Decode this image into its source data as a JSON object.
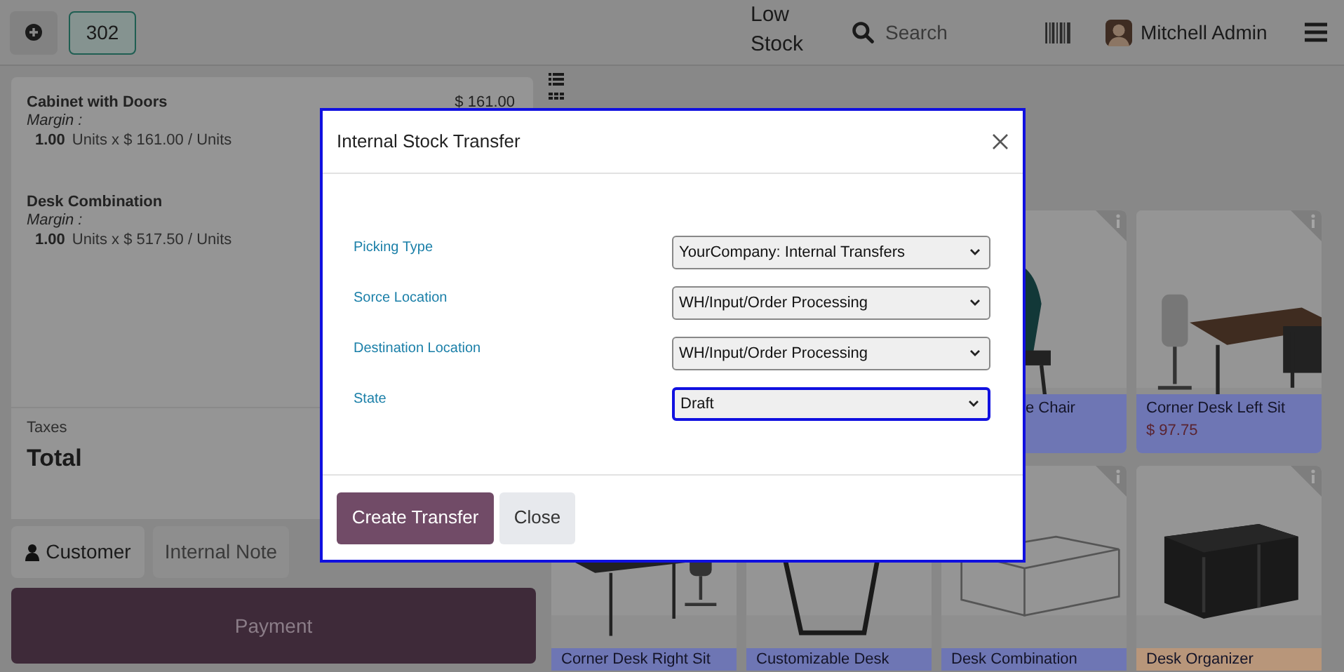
{
  "topbar": {
    "order_number": "302",
    "low_stock": "Low Stock",
    "search": {
      "placeholder": "Search"
    },
    "user": "Mitchell Admin"
  },
  "order_lines": [
    {
      "name": "Cabinet with Doors",
      "margin": "Margin :",
      "quantity": "1.00",
      "unit_price": "Units x $ 161.00 / Units",
      "price": "$ 161.00"
    },
    {
      "name": "Desk Combination",
      "margin": "Margin :",
      "quantity": "1.00",
      "unit_price": "Units x $ 517.50 / Units"
    }
  ],
  "totals": {
    "taxes": "Taxes",
    "total": "Total"
  },
  "actions": {
    "customer": "Customer",
    "internal_note": "Internal Note",
    "payment": "Payment"
  },
  "top_row": [
    {
      "name": "e Chair",
      "kind": "partial",
      "color": "#6e76b4"
    },
    {
      "name": "Corner Desk Left Sit",
      "price": "$ 97.75",
      "kind": "full",
      "color": "#6e76b4"
    }
  ],
  "bottom_row": [
    {
      "name": "Corner Desk Right Sit",
      "color": "#6e76b4"
    },
    {
      "name": "Customizable Desk",
      "color": "#6e76b4"
    },
    {
      "name": "Desk Combination",
      "color": "#6e76b4"
    },
    {
      "name": "Desk Organizer",
      "color": "#b8967a"
    }
  ],
  "dialog": {
    "title": "Internal Stock Transfer",
    "fields": [
      {
        "label": "Picking Type",
        "value": "YourCompany: Internal Transfers",
        "focused": false
      },
      {
        "label": "Sorce Location",
        "value": "WH/Input/Order Processing",
        "focused": false
      },
      {
        "label": "Destination Location",
        "value": "WH/Input/Order Processing",
        "focused": false
      },
      {
        "label": "State",
        "value": "Draft",
        "focused": true
      }
    ],
    "buttons": [
      {
        "label": "Create Transfer",
        "kind": "primary"
      },
      {
        "label": "Close",
        "kind": "secondary"
      }
    ]
  }
}
